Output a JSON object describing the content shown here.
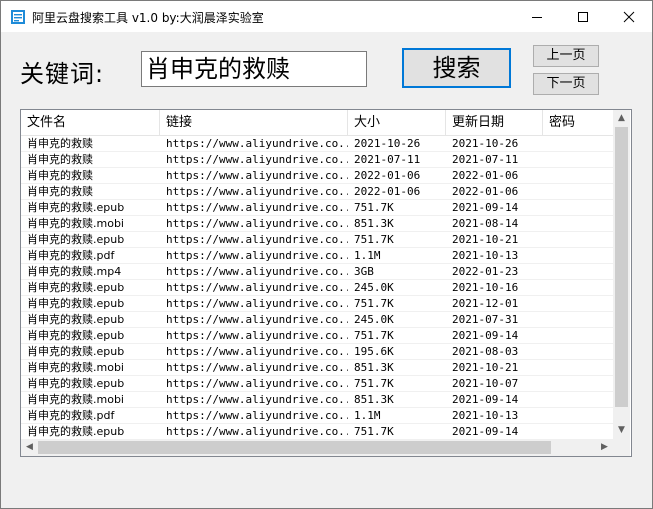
{
  "window": {
    "title": "阿里云盘搜索工具 v1.0  by:大润晨泽实验室",
    "controls": {
      "minimize": "minimize",
      "maximize": "maximize",
      "close": "close"
    }
  },
  "search": {
    "label": "关键词:",
    "value": "肖申克的救赎",
    "button": "搜索",
    "prev_page": "上一页",
    "next_page": "下一页"
  },
  "table": {
    "columns": [
      "文件名",
      "链接",
      "大小",
      "更新日期",
      "密码"
    ],
    "rows": [
      [
        "肖申克的救赎",
        "https://www.aliyundrive.co...",
        "2021-10-26",
        "2021-10-26",
        ""
      ],
      [
        "肖申克的救赎",
        "https://www.aliyundrive.co...",
        "2021-07-11",
        "2021-07-11",
        ""
      ],
      [
        "肖申克的救赎",
        "https://www.aliyundrive.co...",
        "2022-01-06",
        "2022-01-06",
        ""
      ],
      [
        "肖申克的救赎",
        "https://www.aliyundrive.co...",
        "2022-01-06",
        "2022-01-06",
        ""
      ],
      [
        "肖申克的救赎.epub",
        "https://www.aliyundrive.co...",
        "751.7K",
        "2021-09-14",
        ""
      ],
      [
        "肖申克的救赎.mobi",
        "https://www.aliyundrive.co...",
        "851.3K",
        "2021-08-14",
        ""
      ],
      [
        "肖申克的救赎.epub",
        "https://www.aliyundrive.co...",
        "751.7K",
        "2021-10-21",
        ""
      ],
      [
        "肖申克的救赎.pdf",
        "https://www.aliyundrive.co...",
        "1.1M",
        "2021-10-13",
        ""
      ],
      [
        "肖申克的救赎.mp4",
        "https://www.aliyundrive.co...",
        "3GB",
        "2022-01-23",
        ""
      ],
      [
        "肖申克的救赎.epub",
        "https://www.aliyundrive.co...",
        "245.0K",
        "2021-10-16",
        ""
      ],
      [
        "肖申克的救赎.epub",
        "https://www.aliyundrive.co...",
        "751.7K",
        "2021-12-01",
        ""
      ],
      [
        "肖申克的救赎.epub",
        "https://www.aliyundrive.co...",
        "245.0K",
        "2021-07-31",
        ""
      ],
      [
        "肖申克的救赎.epub",
        "https://www.aliyundrive.co...",
        "751.7K",
        "2021-09-14",
        ""
      ],
      [
        "肖申克的救赎.epub",
        "https://www.aliyundrive.co...",
        "195.6K",
        "2021-08-03",
        ""
      ],
      [
        "肖申克的救赎.mobi",
        "https://www.aliyundrive.co...",
        "851.3K",
        "2021-10-21",
        ""
      ],
      [
        "肖申克的救赎.epub",
        "https://www.aliyundrive.co...",
        "751.7K",
        "2021-10-07",
        ""
      ],
      [
        "肖申克的救赎.mobi",
        "https://www.aliyundrive.co...",
        "851.3K",
        "2021-09-14",
        ""
      ],
      [
        "肖申克的救赎.pdf",
        "https://www.aliyundrive.co...",
        "1.1M",
        "2021-10-13",
        ""
      ],
      [
        "肖申克的救赎.epub",
        "https://www.aliyundrive.co...",
        "751.7K",
        "2021-09-14",
        ""
      ]
    ]
  },
  "colors": {
    "focus_border": "#0078d7",
    "app_icon": "#1e8bd8"
  }
}
